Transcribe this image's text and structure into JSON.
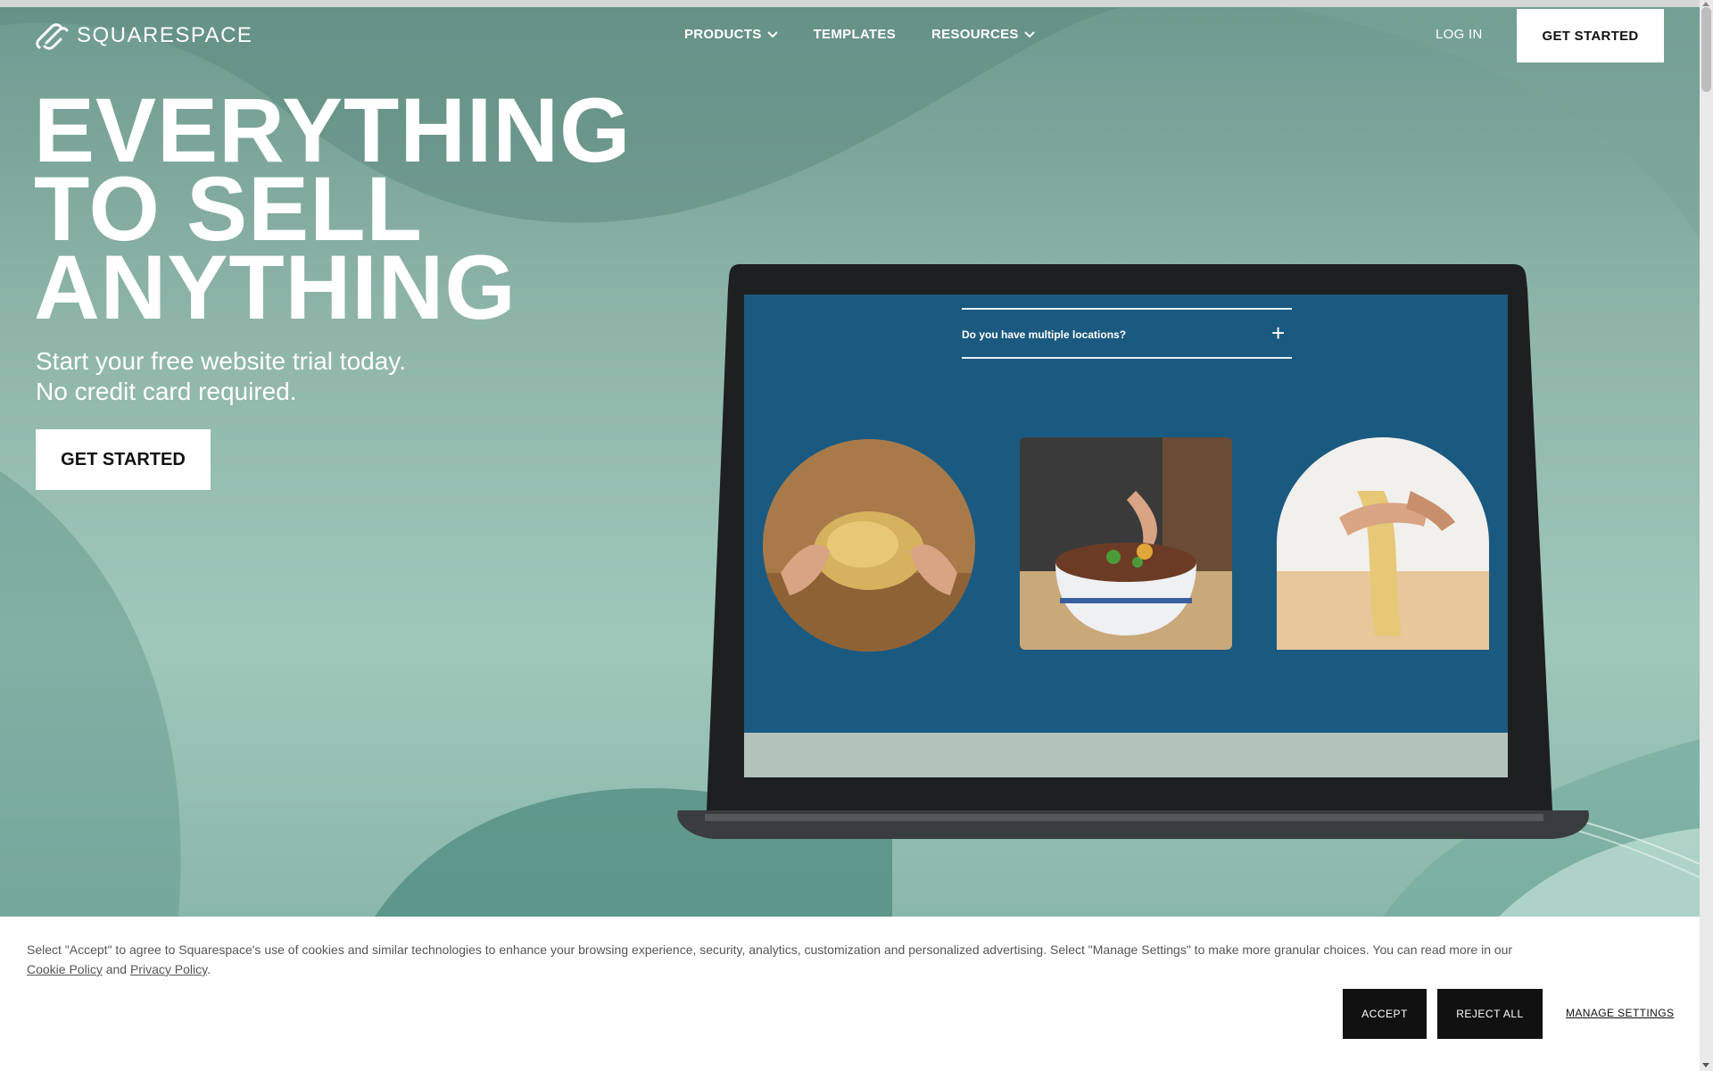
{
  "header": {
    "logo_text": "SQUARESPACE",
    "nav": [
      {
        "label": "PRODUCTS",
        "has_dropdown": true
      },
      {
        "label": "TEMPLATES",
        "has_dropdown": false
      },
      {
        "label": "RESOURCES",
        "has_dropdown": true
      }
    ],
    "login_label": "LOG IN",
    "cta_label": "GET STARTED"
  },
  "hero": {
    "headline": [
      "EVERYTHING",
      "TO SELL",
      "ANYTHING"
    ],
    "subtitle": [
      "Start your free website trial today.",
      "No credit card required."
    ],
    "cta_label": "GET STARTED"
  },
  "laptop_screen": {
    "faq_question": "Do you have multiple locations?",
    "faq_toggle": "+",
    "photos": [
      "noodles-circle-photo",
      "noodle-bowl-photo",
      "noodles-arch-photo"
    ]
  },
  "cookie_banner": {
    "text": "Select \"Accept\" to agree to Squarespace's use of cookies and similar technologies to enhance your browsing experience, security, analytics, customization and personalized advertising. Select \"Manage Settings\" to make more granular choices. You can read more in our",
    "cookie_policy": "Cookie Policy",
    "and": "and",
    "privacy_policy": "Privacy Policy",
    "period": ".",
    "accept_label": "ACCEPT",
    "reject_label": "REJECT ALL",
    "manage_label": "MANAGE SETTINGS"
  },
  "colors": {
    "hero_teal": "#8fb5a9",
    "screen_blue": "#1b5a80",
    "button_dark": "#111111",
    "button_light": "#ffffff"
  }
}
